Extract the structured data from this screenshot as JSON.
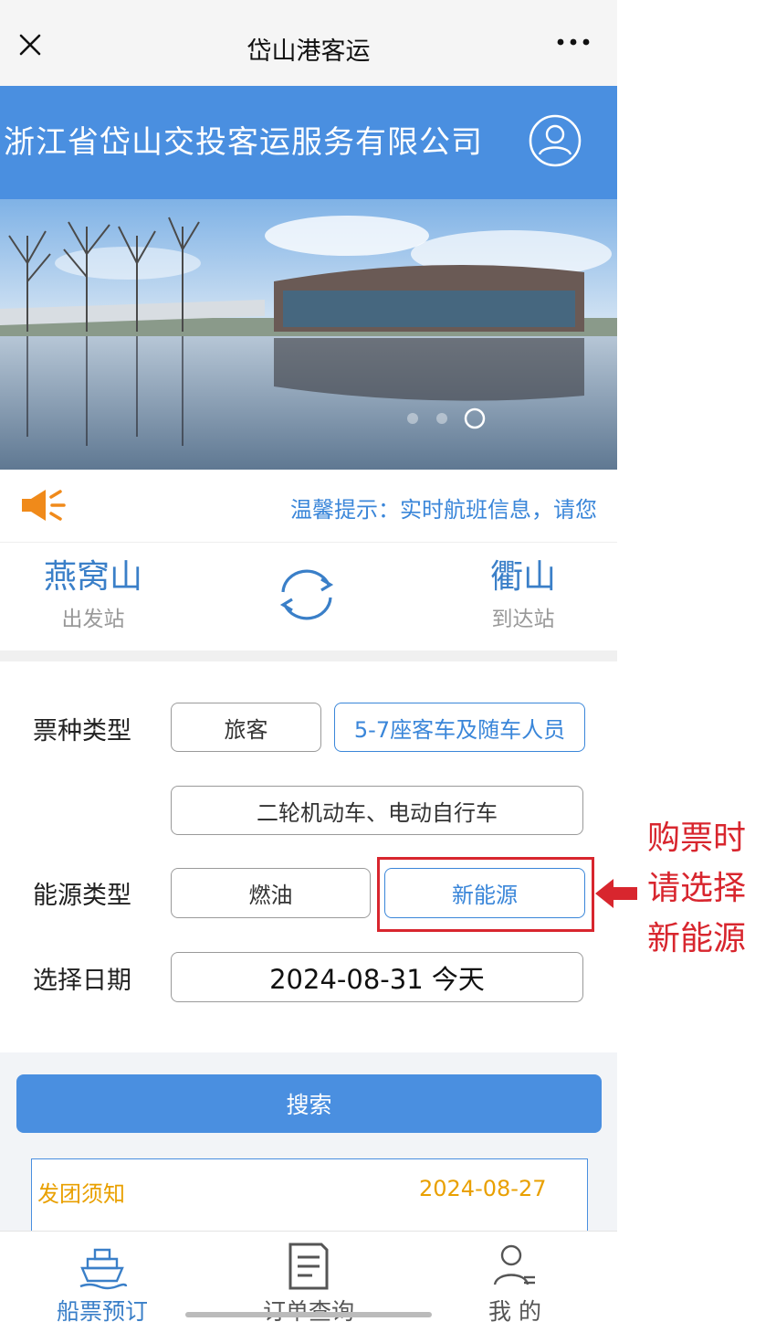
{
  "topbar": {
    "title": "岱山港客运",
    "close_icon": "close-icon",
    "more_icon": "more-icon"
  },
  "header": {
    "company": "浙江省岱山交投客运服务有限公司",
    "avatar_icon": "user-icon"
  },
  "banner": {
    "slide_count": 3,
    "active_slide": 3
  },
  "notice": {
    "text": "温馨提示：实时航班信息，请您",
    "icon": "speaker-icon"
  },
  "stations": {
    "from_name": "燕窝山",
    "from_label": "出发站",
    "to_name": "衢山",
    "to_label": "到达站",
    "swap_icon": "swap-icon"
  },
  "form": {
    "ticket_type_label": "票种类型",
    "ticket_types": [
      "旅客",
      "5-7座客车及随车人员",
      "二轮机动车、电动自行车"
    ],
    "ticket_type_selected": "5-7座客车及随车人员",
    "energy_type_label": "能源类型",
    "energy_types": [
      "燃油",
      "新能源"
    ],
    "energy_type_selected": "新能源",
    "date_label": "选择日期",
    "date_value": "2024-08-31 今天"
  },
  "search": {
    "label": "搜索"
  },
  "announcement": {
    "title": "发团须知",
    "date": "2024-08-27"
  },
  "bottom_nav": [
    {
      "label": "船票预订",
      "icon": "ship-icon",
      "active": true
    },
    {
      "label": "订单查询",
      "icon": "document-icon",
      "active": false
    },
    {
      "label": "我 的",
      "icon": "profile-icon",
      "active": false
    }
  ],
  "annotation": {
    "lines": [
      "购票时",
      "请选择",
      "新能源"
    ],
    "color": "#d8262e"
  },
  "colors": {
    "brand_blue": "#4a8fe0",
    "station_blue": "#3a7fc8",
    "notice_orange": "#e9a000"
  }
}
